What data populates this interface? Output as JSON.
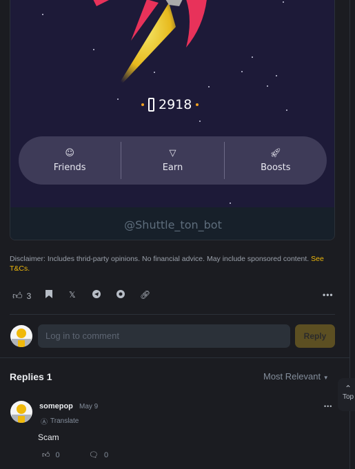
{
  "card": {
    "score": "2918",
    "nav": [
      {
        "label": "Friends",
        "icon": "astronaut-icon"
      },
      {
        "label": "Earn",
        "icon": "ton-icon"
      },
      {
        "label": "Boosts",
        "icon": "rocket-icon"
      }
    ],
    "caption": "@Shuttle_ton_bot"
  },
  "disclaimer": {
    "text": "Disclaimer: Includes thrid-party opinions. No financial advice. May include sponsored content. ",
    "link": "See T&Cs."
  },
  "actions": {
    "like_count": "3"
  },
  "comment": {
    "placeholder": "Log in to comment",
    "reply_label": "Reply"
  },
  "replies": {
    "title": "Replies 1",
    "sort": "Most Relevant",
    "top_label": "Top",
    "items": [
      {
        "user": "somepop",
        "date": "May 9",
        "translate": "Translate",
        "text": "Scam",
        "likes": "0",
        "comments": "0"
      }
    ]
  },
  "colors": {
    "accent": "#f0b90b",
    "background": "#1b1c21"
  }
}
